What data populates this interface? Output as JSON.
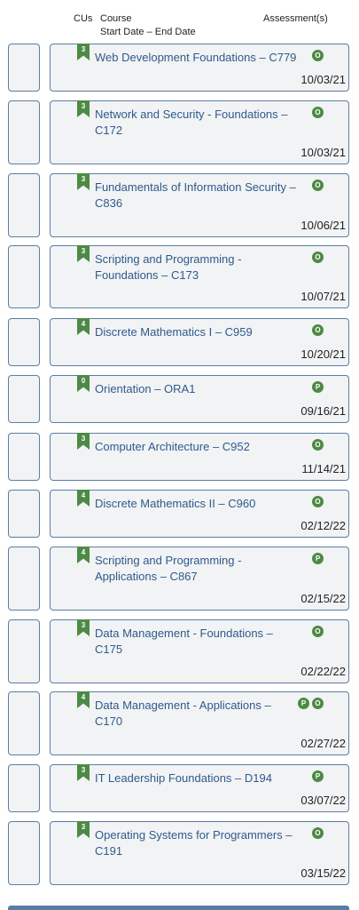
{
  "header": {
    "cus_label": "CUs",
    "course_label": "Course",
    "dates_label": "Start Date – End Date",
    "assessments_label": "Assessment(s)"
  },
  "courses": [
    {
      "cus": "3",
      "title": "Web Development Foundations – C779",
      "assessments": [
        "O"
      ],
      "date": "10/03/21"
    },
    {
      "cus": "3",
      "title": "Network and Security - Foundations – C172",
      "assessments": [
        "O"
      ],
      "date": "10/03/21"
    },
    {
      "cus": "3",
      "title": "Fundamentals of Information Security – C836",
      "assessments": [
        "O"
      ],
      "date": "10/06/21"
    },
    {
      "cus": "3",
      "title": "Scripting and Programming - Foundations – C173",
      "assessments": [
        "O"
      ],
      "date": "10/07/21"
    },
    {
      "cus": "4",
      "title": "Discrete Mathematics I – C959",
      "assessments": [
        "O"
      ],
      "date": "10/20/21"
    },
    {
      "cus": "0",
      "title": "Orientation – ORA1",
      "assessments": [
        "P"
      ],
      "date": "09/16/21"
    },
    {
      "cus": "3",
      "title": "Computer Architecture – C952",
      "assessments": [
        "O"
      ],
      "date": "11/14/21"
    },
    {
      "cus": "4",
      "title": "Discrete Mathematics II – C960",
      "assessments": [
        "O"
      ],
      "date": "02/12/22"
    },
    {
      "cus": "4",
      "title": "Scripting and Programming - Applications – C867",
      "assessments": [
        "P"
      ],
      "date": "02/15/22"
    },
    {
      "cus": "3",
      "title": "Data Management - Foundations – C175",
      "assessments": [
        "O"
      ],
      "date": "02/22/22"
    },
    {
      "cus": "4",
      "title": "Data Management - Applications – C170",
      "assessments": [
        "P",
        "O"
      ],
      "date": "02/27/22"
    },
    {
      "cus": "3",
      "title": "IT Leadership Foundations – D194",
      "assessments": [
        "P"
      ],
      "date": "03/07/22"
    },
    {
      "cus": "3",
      "title": "Operating Systems for Programmers – C191",
      "assessments": [
        "O"
      ],
      "date": "03/15/22"
    }
  ],
  "colors": {
    "badge": "#4d8a45",
    "link": "#2e5a8c",
    "border": "#5a7ea3"
  }
}
